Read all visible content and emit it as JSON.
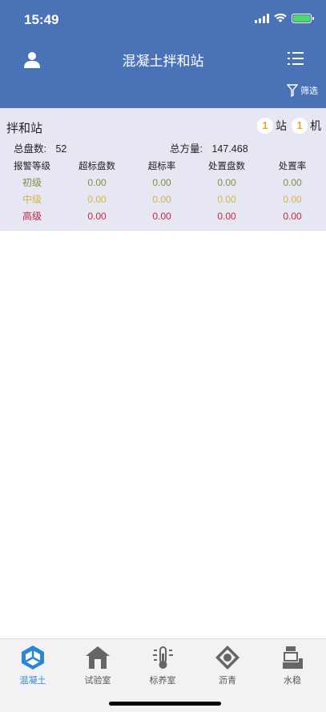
{
  "status": {
    "time": "15:49"
  },
  "header": {
    "title": "混凝土拌和站",
    "filter_label": "筛选"
  },
  "panel": {
    "title": "拌和站",
    "station_count": "1",
    "station_unit": "站",
    "machine_count": "1",
    "machine_unit": "机",
    "total_batches_label": "总盘数:",
    "total_batches_value": "52",
    "total_volume_label": "总方量:",
    "total_volume_value": "147.468"
  },
  "table": {
    "headers": [
      "报警等级",
      "超标盘数",
      "超标率",
      "处置盘数",
      "处置率"
    ],
    "rows": [
      {
        "level": "初级",
        "values": [
          "0.00",
          "0.00",
          "0.00",
          "0.00"
        ]
      },
      {
        "level": "中级",
        "values": [
          "0.00",
          "0.00",
          "0.00",
          "0.00"
        ]
      },
      {
        "level": "高级",
        "values": [
          "0.00",
          "0.00",
          "0.00",
          "0.00"
        ]
      }
    ]
  },
  "tabs": [
    {
      "label": "混凝土",
      "icon": "concrete-icon",
      "active": true
    },
    {
      "label": "试验室",
      "icon": "lab-house-icon",
      "active": false
    },
    {
      "label": "标养室",
      "icon": "thermometer-icon",
      "active": false
    },
    {
      "label": "沥青",
      "icon": "asphalt-icon",
      "active": false
    },
    {
      "label": "水稳",
      "icon": "water-stable-icon",
      "active": false
    }
  ],
  "colors": {
    "header": "#4a72b7",
    "panel": "#e7e7f4",
    "level_primary": "#7d8f45",
    "level_medium": "#d6b24c",
    "level_high": "#c0283a",
    "active_tab": "#2a86d6"
  }
}
